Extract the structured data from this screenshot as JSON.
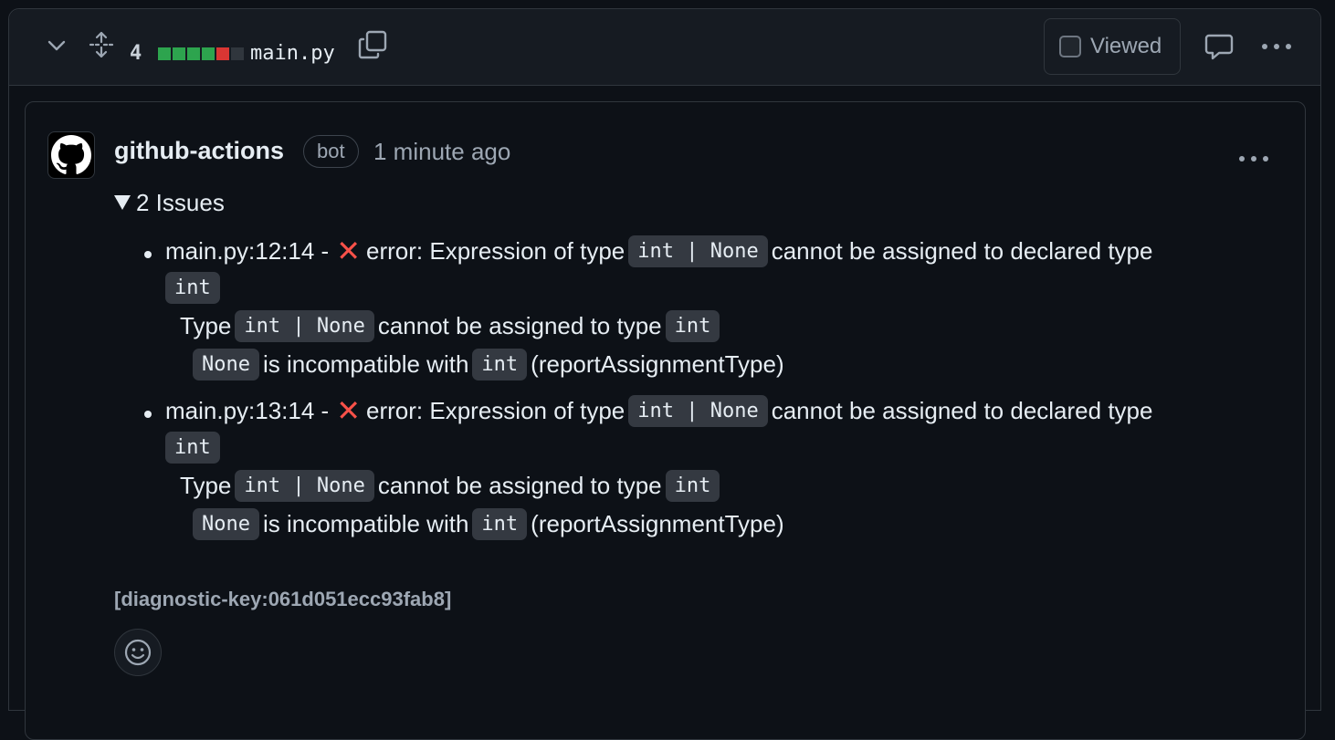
{
  "file_header": {
    "diff_count": "4",
    "diffstat": [
      "#2da44e",
      "#2da44e",
      "#2da44e",
      "#2da44e",
      "#da3633",
      "#30363d"
    ],
    "file_name": "main.py",
    "viewed_label": "Viewed"
  },
  "comment": {
    "author": "github-actions",
    "badge": "bot",
    "timestamp": "1 minute ago",
    "summary": "2 Issues",
    "issues": [
      {
        "location": "main.py:12:14 -",
        "error_prefix": "error: Expression of type",
        "type1": "int | None",
        "mid": "cannot be assigned to declared type",
        "type2": "int",
        "detail_prefix": "Type",
        "detail_type": "int | None",
        "detail_mid": "cannot be assigned to type",
        "detail_type2": "int",
        "sub_code": "None",
        "sub_mid": "is incompatible with",
        "sub_code2": "int",
        "sub_tail": "(reportAssignmentType)"
      },
      {
        "location": "main.py:13:14 -",
        "error_prefix": "error: Expression of type",
        "type1": "int | None",
        "mid": "cannot be assigned to declared type",
        "type2": "int",
        "detail_prefix": "Type",
        "detail_type": "int | None",
        "detail_mid": "cannot be assigned to type",
        "detail_type2": "int",
        "sub_code": "None",
        "sub_mid": "is incompatible with",
        "sub_code2": "int",
        "sub_tail": "(reportAssignmentType)"
      }
    ],
    "diagnostic_key": "[diagnostic-key:061d051ecc93fab8]"
  },
  "icons": {
    "collapse": "chevron-down-icon",
    "expand": "unfold-icon",
    "copy": "copy-icon",
    "comment": "comment-icon",
    "more": "kebab-horizontal-icon",
    "avatar": "github-mark-icon",
    "emoji": "smiley-icon",
    "error": "x-mark-icon"
  }
}
